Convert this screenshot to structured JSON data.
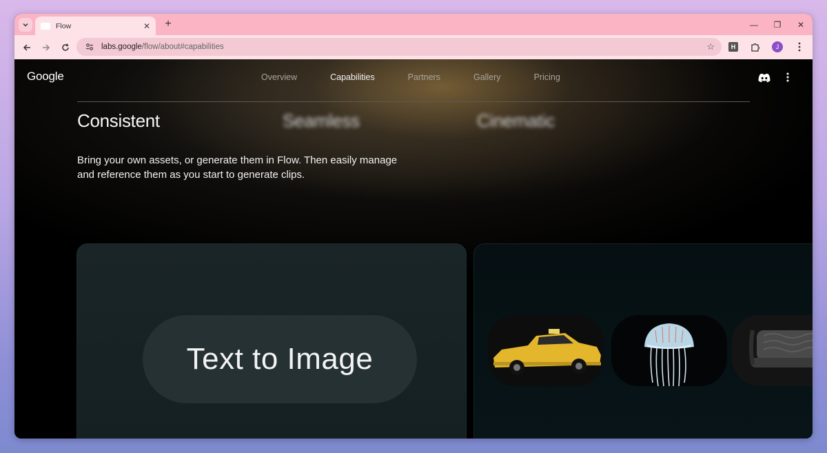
{
  "browser": {
    "tab_title": "Flow",
    "url_host": "labs.google",
    "url_path": "/flow/about#capabilities",
    "extension_label": "H",
    "profile_initial": "J"
  },
  "site": {
    "logo": "Google",
    "nav": [
      {
        "label": "Overview",
        "active": false
      },
      {
        "label": "Capabilities",
        "active": true
      },
      {
        "label": "Partners",
        "active": false
      },
      {
        "label": "Gallery",
        "active": false
      },
      {
        "label": "Pricing",
        "active": false
      }
    ],
    "capability_tabs": [
      "Consistent",
      "Seamless",
      "Cinematic"
    ],
    "description": "Bring your own assets, or generate them in Flow. Then easily manage and reference them as you start to generate clips.",
    "card_label": "Text to Image",
    "thumbnails": [
      "taxi-image",
      "jellyfish-image",
      "car-seat-image"
    ]
  },
  "colors": {
    "tabstrip": "#fbb4c4",
    "toolbar": "#fde2e8",
    "accent_avatar": "#8a4fc8"
  }
}
